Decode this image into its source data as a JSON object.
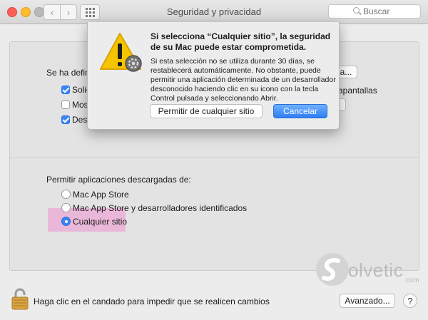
{
  "window": {
    "title": "Seguridad y privacidad"
  },
  "toolbar": {
    "back": "‹",
    "forward": "›"
  },
  "search": {
    "placeholder": "Buscar"
  },
  "general": {
    "label_partial": "Se ha defini",
    "button_partial": "a...",
    "checkbox1_partial": "Solic",
    "checkbox1_suffix": "apantallas",
    "checkbox2_partial": "Mos",
    "checkbox3_partial": "Desa"
  },
  "downloads": {
    "heading": "Permitir aplicaciones descargadas de:",
    "options": [
      "Mac App Store",
      "Mac App Store y desarrolladores identificados",
      "Cualquier sitio"
    ],
    "selected": "Cualquier sitio"
  },
  "dialog": {
    "title": "Si selecciona “Cualquier sitio”, la seguridad de su Mac puede estar comprometida.",
    "body": "Si esta selección no se utiliza durante 30 días, se restablecerá automáticamente. No obstante, puede permitir una aplicación determinada de un desarrollador desconocido haciendo clic en su icono con la tecla Control pulsada y seleccionando Abrir.",
    "allow_button": "Permitir de cualquier sitio",
    "cancel_button": "Cancelar"
  },
  "footer": {
    "lock_text": "Haga clic en el candado para impedir que se realicen cambios",
    "advanced_button": "Avanzado...",
    "help": "?"
  },
  "watermark": {
    "text": "olvetic",
    "suffix": ".com"
  },
  "colors": {
    "accent": "#3b86f7",
    "highlight": "#e9b8d8",
    "warning": "#f6c400"
  }
}
